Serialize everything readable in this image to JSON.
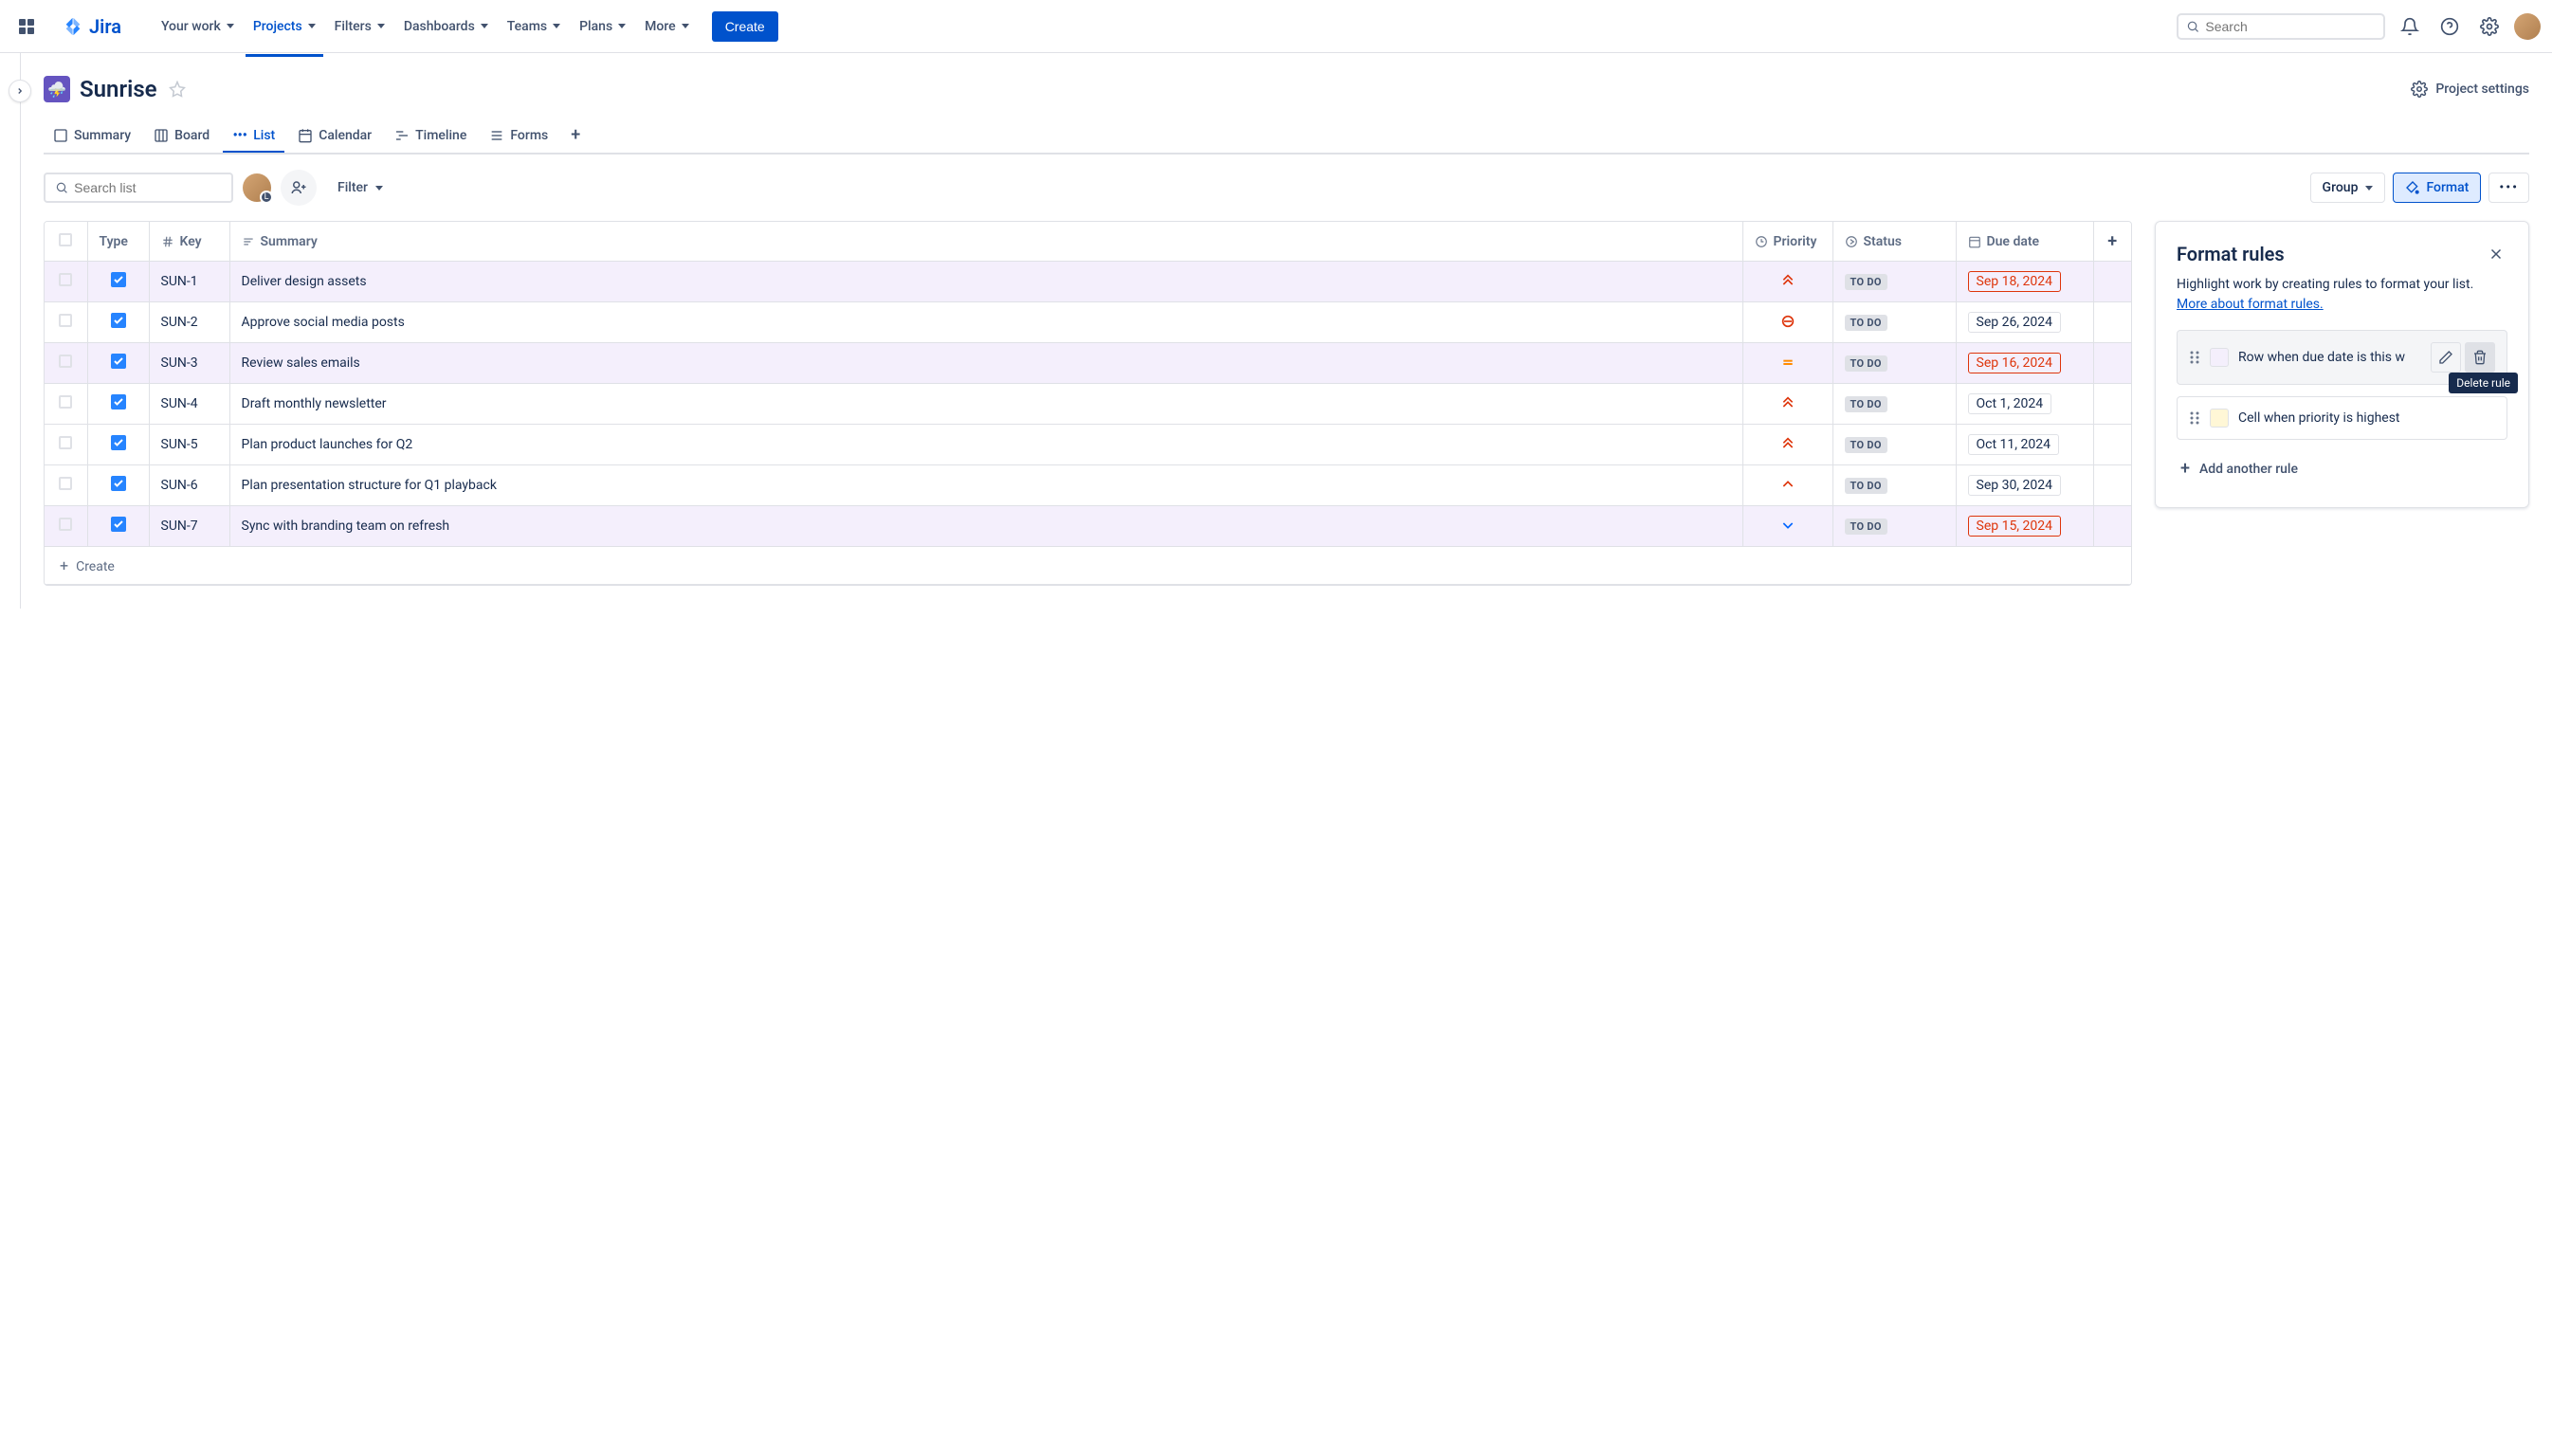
{
  "nav": {
    "items": [
      "Your work",
      "Projects",
      "Filters",
      "Dashboards",
      "Teams",
      "Plans",
      "More"
    ],
    "active": "Projects",
    "create": "Create",
    "search_placeholder": "Search",
    "logo": "Jira"
  },
  "project": {
    "title": "Sunrise",
    "settings_label": "Project settings"
  },
  "tabs": {
    "items": [
      "Summary",
      "Board",
      "List",
      "Calendar",
      "Timeline",
      "Forms"
    ],
    "active": "List"
  },
  "toolbar": {
    "search_placeholder": "Search list",
    "filter": "Filter",
    "group": "Group",
    "format": "Format"
  },
  "columns": {
    "type": "Type",
    "key": "Key",
    "summary": "Summary",
    "priority": "Priority",
    "status": "Status",
    "due_date": "Due date"
  },
  "rows": [
    {
      "key": "SUN-1",
      "summary": "Deliver design assets",
      "priority": "highest",
      "status": "TO DO",
      "due": "Sep 18, 2024",
      "overdue": true,
      "highlight": true
    },
    {
      "key": "SUN-2",
      "summary": "Approve social media posts",
      "priority": "blocker",
      "status": "TO DO",
      "due": "Sep 26, 2024",
      "overdue": false,
      "highlight": false
    },
    {
      "key": "SUN-3",
      "summary": "Review sales emails",
      "priority": "medium",
      "status": "TO DO",
      "due": "Sep 16, 2024",
      "overdue": true,
      "highlight": true
    },
    {
      "key": "SUN-4",
      "summary": "Draft monthly newsletter",
      "priority": "highest",
      "status": "TO DO",
      "due": "Oct 1, 2024",
      "overdue": false,
      "highlight": false
    },
    {
      "key": "SUN-5",
      "summary": "Plan product launches for Q2",
      "priority": "highest",
      "status": "TO DO",
      "due": "Oct 11, 2024",
      "overdue": false,
      "highlight": false
    },
    {
      "key": "SUN-6",
      "summary": "Plan presentation structure for Q1 playback",
      "priority": "high",
      "status": "TO DO",
      "due": "Sep 30, 2024",
      "overdue": false,
      "highlight": false
    },
    {
      "key": "SUN-7",
      "summary": "Sync with branding team on refresh",
      "priority": "low",
      "status": "TO DO",
      "due": "Sep 15, 2024",
      "overdue": true,
      "highlight": true
    }
  ],
  "create_label": "Create",
  "panel": {
    "title": "Format rules",
    "desc": "Highlight work by creating rules to format your list. ",
    "link": "More about format rules.",
    "rules": [
      {
        "text": "Row when due date is this w",
        "swatch": "#F4EFFC",
        "hover": true
      },
      {
        "text": "Cell when priority is highest",
        "swatch": "#FFF7D6",
        "hover": false
      }
    ],
    "tooltip": "Delete rule",
    "add": "Add another rule"
  }
}
